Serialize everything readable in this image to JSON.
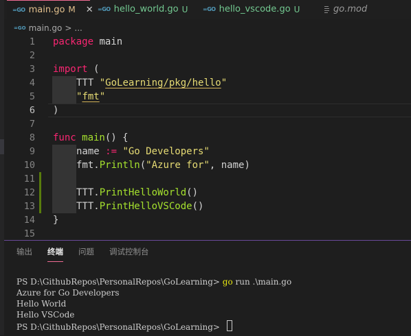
{
  "tabs": [
    {
      "name": "main.go",
      "status": "M",
      "icon": "go-file-icon",
      "active": true
    },
    {
      "name": "hello_world.go",
      "status": "U",
      "icon": "go-file-icon"
    },
    {
      "name": "hello_vscode.go",
      "status": "U",
      "icon": "go-file-icon"
    },
    {
      "name": "go.mod",
      "icon": "file-lines-icon"
    }
  ],
  "breadcrumb": {
    "file": "main.go",
    "sep": ">",
    "more": "..."
  },
  "editor": {
    "line_numbers": [
      "1",
      "2",
      "3",
      "4",
      "5",
      "6",
      "7",
      "8",
      "9",
      "10",
      "11",
      "12",
      "13",
      "14",
      "15"
    ],
    "current_line": "6",
    "code": {
      "l1_kw": "package",
      "l1_name": " main",
      "l3_kw": "import",
      "l3_paren": " (",
      "l4_alias": "TTT ",
      "l4_q1": "\"",
      "l4_path": "GoLearning/pkg/hello",
      "l4_q2": "\"",
      "l5_q1": "\"",
      "l5_path": "fmt",
      "l5_q2": "\"",
      "l6": ")",
      "l8_kw": "func",
      "l8_name": " main",
      "l8_rest": "() {",
      "l9_var": "name ",
      "l9_op": ":=",
      "l9_str": " \"Go Developers\"",
      "l10_pkg": "fmt.",
      "l10_fn": "Println",
      "l10_open": "(",
      "l10_str": "\"Azure for\"",
      "l10_rest": ", name)",
      "l12_pkg": "TTT.",
      "l12_fn": "PrintHelloWorld",
      "l12_rest": "()",
      "l13_pkg": "TTT.",
      "l13_fn": "PrintHelloVSCode",
      "l13_rest": "()",
      "l14": "}"
    }
  },
  "panel": {
    "tabs": [
      "输出",
      "终端",
      "问题",
      "调试控制台"
    ],
    "active_tab": "终端",
    "terminal": {
      "prompt1": "PS D:\\GithubRepos\\PersonalRepos\\GoLearning> ",
      "cmd1": "go",
      "cmd1_rest": " run .\\main.go",
      "out1": "Azure for Go Developers",
      "out2": "Hello World",
      "out3": "Hello VSCode",
      "prompt2": "PS D:\\GithubRepos\\PersonalRepos\\GoLearning> "
    }
  },
  "colors": {
    "accent": "#f26c95",
    "modified": "#e2c08d",
    "untracked": "#73c991",
    "gutter_added": "#587c0c"
  }
}
